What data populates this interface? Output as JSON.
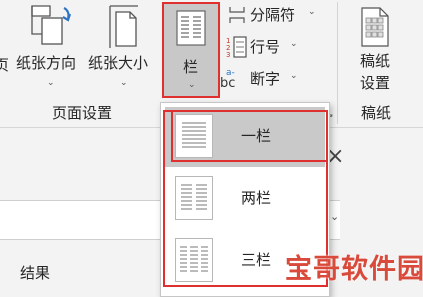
{
  "ribbon": {
    "edge_label": "页",
    "orientation_label": "纸张方向",
    "size_label": "纸张大小",
    "columns_label": "栏",
    "breaks_label": "分隔符",
    "line_numbers_label": "行号",
    "hyphenation_label": "断字",
    "hyphen_icon_text": "bc",
    "manuscript_label_line1": "稿纸",
    "manuscript_label_line2": "设置",
    "group_page_setup": "页面设置",
    "group_manuscript": "稿纸"
  },
  "pane": {
    "result_label": "结果",
    "close_symbol": "×"
  },
  "columns_menu": {
    "items": [
      {
        "label": "一栏",
        "columns": 1,
        "highlighted": true
      },
      {
        "label": "两栏",
        "columns": 2,
        "highlighted": false
      },
      {
        "label": "三栏",
        "columns": 3,
        "highlighted": false
      }
    ]
  },
  "watermark": {
    "text": "宝哥软件园"
  },
  "colors": {
    "ribbon_bg": "#f3f3f3",
    "selected_bg": "#c8c8c8",
    "highlight_red": "#e02f2f",
    "watermark_red": "#d94a3a",
    "icon_blue": "#2e74c4"
  },
  "icons": [
    "page-edge-icon",
    "orientation-icon",
    "paper-size-icon",
    "columns-icon",
    "breaks-icon",
    "line-numbers-icon",
    "hyphenation-icon",
    "manuscript-icon",
    "close-icon",
    "one-column-icon",
    "two-columns-icon",
    "three-columns-icon"
  ]
}
